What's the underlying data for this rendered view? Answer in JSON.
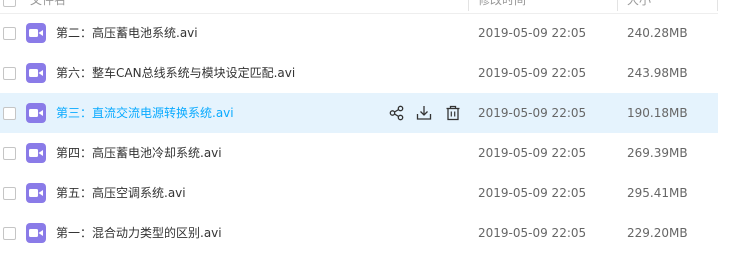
{
  "header": {
    "col_name": "文件名",
    "col_modified": "修改时间",
    "col_size": "大小"
  },
  "colors": {
    "video_icon": "#8a7be8",
    "hover_bg": "#e5f3fd",
    "hover_text": "#09aaff"
  },
  "files": [
    {
      "name": "第二：高压蓄电池系统.avi",
      "modified": "2019-05-09 22:05",
      "size": "240.28MB",
      "icon": "video-file-icon"
    },
    {
      "name": "第六：整车CAN总线系统与模块设定匹配.avi",
      "modified": "2019-05-09 22:05",
      "size": "243.98MB",
      "icon": "video-file-icon"
    },
    {
      "name": "第三：直流交流电源转换系统.avi",
      "modified": "2019-05-09 22:05",
      "size": "190.18MB",
      "icon": "video-file-icon",
      "hovered": true,
      "actions": [
        "share-icon",
        "download-icon",
        "delete-icon"
      ]
    },
    {
      "name": "第四：高压蓄电池冷却系统.avi",
      "modified": "2019-05-09 22:05",
      "size": "269.39MB",
      "icon": "video-file-icon"
    },
    {
      "name": "第五：高压空调系统.avi",
      "modified": "2019-05-09 22:05",
      "size": "295.41MB",
      "icon": "video-file-icon"
    },
    {
      "name": "第一：混合动力类型的区别.avi",
      "modified": "2019-05-09 22:05",
      "size": "229.20MB",
      "icon": "video-file-icon"
    }
  ]
}
